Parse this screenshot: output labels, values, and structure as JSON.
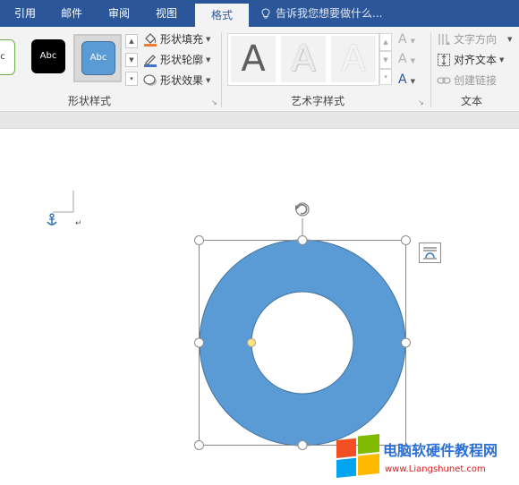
{
  "tabs": [
    {
      "label": "引用"
    },
    {
      "label": "邮件"
    },
    {
      "label": "审阅"
    },
    {
      "label": "视图"
    },
    {
      "label": "格式"
    }
  ],
  "tell_me": "告诉我您想要做什么...",
  "shape_styles": {
    "swatches": [
      "Abc",
      "Abc",
      "Abc"
    ],
    "partial_swatch": "c",
    "fill": "形状填充",
    "outline": "形状轮廓",
    "effects": "形状效果",
    "group_label": "形状样式"
  },
  "wordart": {
    "letters": [
      "A",
      "A",
      "A"
    ],
    "side_letters": [
      "A",
      "A",
      "A"
    ],
    "group_label": "艺术字样式"
  },
  "text_group": {
    "direction": "文字方向",
    "align": "对齐文本",
    "link": "创建链接",
    "group_label": "文本"
  },
  "colors": {
    "tab_bar": "#2b579a",
    "ribbon_bg": "#f3f3f3",
    "shape_fill": "#5b9bd5",
    "shape_stroke": "#41719c",
    "adjust_handle": "#ffe47a"
  },
  "document": {
    "anchor_icon": "anchor-icon",
    "paragraph_mark": "↵",
    "shape": "donut",
    "layout_options_icon": "layout-options-icon"
  },
  "watermark": {
    "title": "电脑软硬件教程网",
    "url": "www.Liangshunet.com"
  }
}
